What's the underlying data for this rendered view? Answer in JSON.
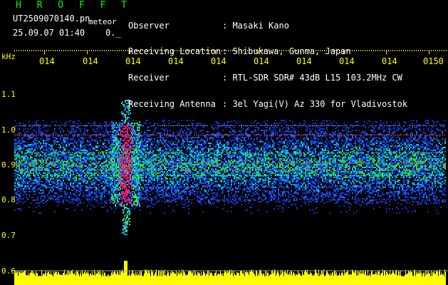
{
  "header": {
    "app_title": "H R O F F T",
    "file_name": "UT2509070140.pn",
    "tag": "meteor",
    "datetime": "25.09.07 01:40",
    "counter": "0._"
  },
  "info": [
    {
      "key": "Observer",
      "value": ": Masaki Kano"
    },
    {
      "key": "Receiving Location",
      "value": ": Shibukawa, Gunma, Japan"
    },
    {
      "key": "Receiver",
      "value": ": RTL-SDR SDR# 43dB L15 103.2MHz CW"
    },
    {
      "key": "Receiving Antenna",
      "value": ": 3el Yagi(V) Az 330 for Vladivostok"
    }
  ],
  "axes": {
    "y_unit": "kHz",
    "y_ticks": [
      "1.1",
      "1.0",
      "0.9",
      "0.8",
      "0.7",
      "0.6"
    ],
    "x_ticks": [
      "014",
      "014",
      "014",
      "014",
      "014",
      "014",
      "014",
      "014",
      "014",
      "0150"
    ]
  },
  "colors": {
    "labels": "#ffff00",
    "title": "#00ff00",
    "baseline_fill": "#ffff00"
  }
}
